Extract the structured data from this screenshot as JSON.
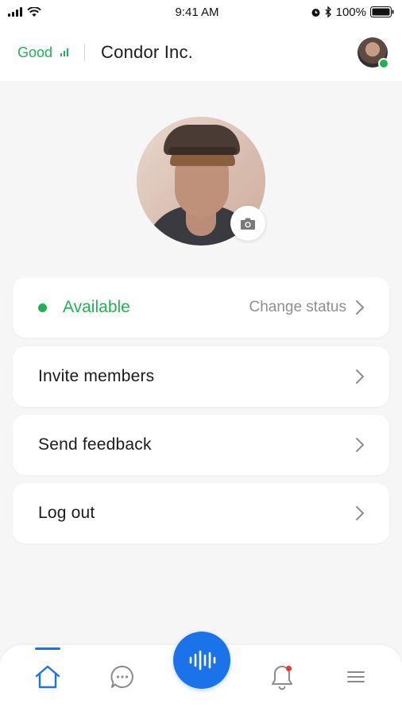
{
  "status_bar": {
    "time": "9:41 AM",
    "battery": "100%"
  },
  "header": {
    "connection_quality": "Good",
    "company": "Condor Inc."
  },
  "menu": {
    "status_label": "Available",
    "change_status": "Change status",
    "items": [
      {
        "label": "Invite members"
      },
      {
        "label": "Send feedback"
      },
      {
        "label": "Log out"
      }
    ]
  },
  "colors": {
    "accent_green": "#1fb254",
    "primary_blue": "#1a73e8",
    "notification_red": "#e53935"
  },
  "icons": {
    "profile_camera": "camera-icon",
    "nav": [
      "home-icon",
      "chat-icon",
      "voice-icon",
      "bell-icon",
      "menu-icon"
    ]
  }
}
